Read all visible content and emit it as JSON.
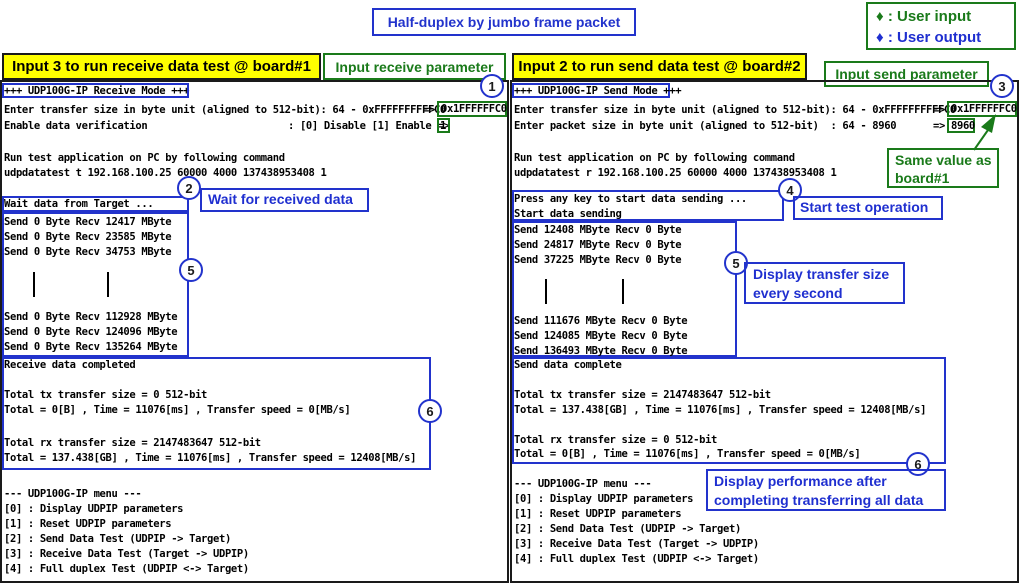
{
  "title": "Half-duplex by jumbo frame packet",
  "legend": {
    "input": "♦ : User input",
    "output": "♦ : User output",
    "input_color": "#1a7a1a",
    "output_color": "#1f2fd0"
  },
  "left": {
    "header": "Input 3 to run receive data test @ board#1",
    "param_label": "Input receive parameter",
    "lines": [
      "+++ UDP100G-IP Receive Mode +++",
      "Enter transfer size in byte unit (aligned to 512-bit): 64 - 0xFFFFFFFFFFC0",
      "Enable data verification",
      "",
      "Run test application on PC by following command",
      "udpdatatest t 192.168.100.25 60000 4000 137438953408 1",
      "",
      "Wait data from Target ...",
      "Send 0 Byte Recv 12417 MByte",
      "Send 0 Byte Recv 23585 MByte",
      "Send 0 Byte Recv 34753 MByte",
      "Send 0 Byte Recv 112928 MByte",
      "Send 0 Byte Recv 124096 MByte",
      "Send 0 Byte Recv 135264 MByte",
      "Receive data completed",
      "Total tx transfer size = 0 512-bit",
      "Total = 0[B] , Time = 11076[ms] , Transfer speed = 0[MB/s]",
      "Total rx transfer size = 2147483647 512-bit",
      "Total = 137.438[GB] , Time = 11076[ms] , Transfer speed = 12408[MB/s]",
      "--- UDP100G-IP menu ---",
      "[0] : Display UDPIP parameters",
      "[1] : Reset UDPIP parameters",
      "[2] : Send Data Test (UDPIP -> Target)",
      "[3] : Receive Data Test (Target -> UDPIP)",
      "[4] : Full duplex Test (UDPIP <-> Target)"
    ],
    "verify_options": ": [0] Disable [1] Enable =>",
    "size_arrow": "=>",
    "input_size": "0x1FFFFFFC0",
    "input_verify": "1",
    "step1": "1",
    "step2": "2",
    "step2_label": "Wait for received data",
    "step5": "5",
    "step6": "6"
  },
  "right": {
    "header": "Input 2 to run send data test @ board#2",
    "param_label": "Input send parameter",
    "lines": [
      "+++ UDP100G-IP Send Mode +++",
      "Enter transfer size in byte unit (aligned to 512-bit): 64 - 0xFFFFFFFFFFC0",
      "Enter packet size in byte unit (aligned to 512-bit)  : 64 - 8960",
      "",
      "Run test application on PC by following command",
      "udpdatatest r 192.168.100.25 60000 4000 137438953408 1",
      "",
      "Press any key to start data sending ...",
      "Start data sending",
      "Send 12408 MByte Recv 0 Byte",
      "Send 24817 MByte Recv 0 Byte",
      "Send 37225 MByte Recv 0 Byte",
      "Send 111676 MByte Recv 0 Byte",
      "Send 124085 MByte Recv 0 Byte",
      "Send 136493 MByte Recv 0 Byte",
      "Send data complete",
      "Total tx transfer size = 2147483647 512-bit",
      "Total = 137.438[GB] , Time = 11076[ms] , Transfer speed = 12408[MB/s]",
      "Total rx transfer size = 0 512-bit",
      "Total = 0[B] , Time = 11076[ms] , Transfer speed = 0[MB/s]",
      "--- UDP100G-IP menu ---",
      "[0] : Display UDPIP parameters",
      "[1] : Reset UDPIP parameters",
      "[2] : Send Data Test (UDPIP -> Target)",
      "[3] : Receive Data Test (Target -> UDPIP)",
      "[4] : Full duplex Test (UDPIP <-> Target)"
    ],
    "arrow1": "=>",
    "arrow2": "=>",
    "input_size": "0x1FFFFFFC0",
    "input_packet": "8960",
    "step3": "3",
    "same_value_label": "Same value as\nboard#1",
    "step4": "4",
    "step4_label": "Start test operation",
    "step5": "5",
    "step5_label": "Display transfer size\nevery second",
    "step6": "6",
    "step6_label": "Display performance after\ncompleting transferring all data"
  }
}
